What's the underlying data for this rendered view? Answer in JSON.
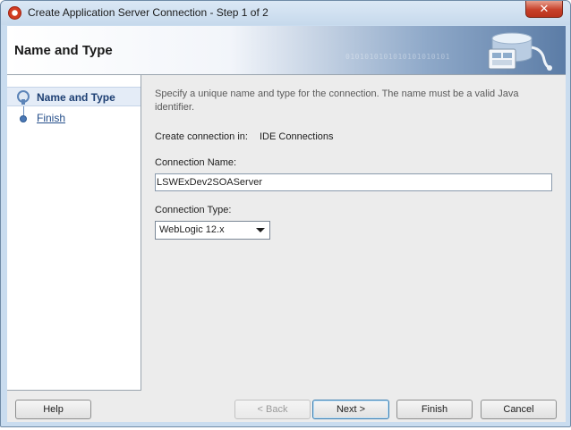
{
  "window": {
    "title": "Create Application Server Connection - Step 1 of 2",
    "close_glyph": "✕"
  },
  "header": {
    "title": "Name and Type",
    "binary_text": "0101010101010101010101",
    "art_icon": "database-server-icon"
  },
  "nav": {
    "items": [
      {
        "label": "Name and Type",
        "state": "active",
        "icon": "step-current-icon"
      },
      {
        "label": "Finish",
        "state": "link",
        "icon": "step-dot-icon"
      }
    ]
  },
  "main": {
    "description": "Specify a unique name and type for the connection. The name must be a valid Java identifier.",
    "create_in_label": "Create connection in:",
    "create_in_value": "IDE Connections",
    "name_label": "Connection Name:",
    "name_value": "LSWExDev2SOAServer",
    "type_label": "Connection Type:",
    "type_value": "WebLogic 12.x"
  },
  "buttons": {
    "help": "Help",
    "back": "< Back",
    "next": "Next >",
    "finish": "Finish",
    "cancel": "Cancel"
  },
  "colors": {
    "accent": "#3c7fb1",
    "nav_link": "#244e8a",
    "close": "#c7402a"
  }
}
